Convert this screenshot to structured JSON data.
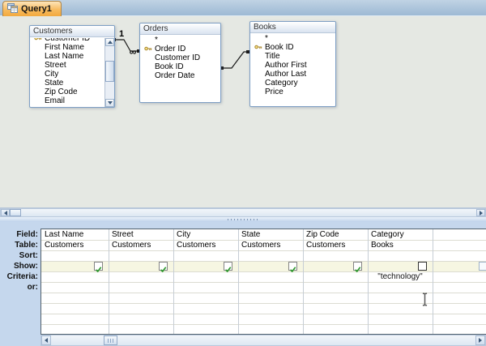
{
  "window": {
    "tab_label": "Query1"
  },
  "design": {
    "tables": [
      {
        "name": "Customers",
        "fields": [
          {
            "label": "Customer ID",
            "key": true,
            "partial": true
          },
          {
            "label": "First Name"
          },
          {
            "label": "Last Name"
          },
          {
            "label": "Street"
          },
          {
            "label": "City"
          },
          {
            "label": "State"
          },
          {
            "label": "Zip Code"
          },
          {
            "label": "Email"
          }
        ],
        "has_scrollbar": true
      },
      {
        "name": "Orders",
        "fields": [
          {
            "label": "*"
          },
          {
            "label": "Order ID",
            "key": true
          },
          {
            "label": "Customer ID"
          },
          {
            "label": "Book ID"
          },
          {
            "label": "Order Date"
          }
        ]
      },
      {
        "name": "Books",
        "fields": [
          {
            "label": "*"
          },
          {
            "label": "Book ID",
            "key": true
          },
          {
            "label": "Title"
          },
          {
            "label": "Author First"
          },
          {
            "label": "Author Last"
          },
          {
            "label": "Category"
          },
          {
            "label": "Price"
          }
        ]
      }
    ],
    "relationships": [
      {
        "from": "Customers",
        "to": "Orders",
        "from_label": "1",
        "to_label": "∞"
      },
      {
        "from": "Orders",
        "to": "Books",
        "from_label": "",
        "to_label": ""
      }
    ]
  },
  "grid": {
    "row_labels": [
      "Field:",
      "Table:",
      "Sort:",
      "Show:",
      "Criteria:",
      "or:"
    ],
    "columns": [
      {
        "field": "Last Name",
        "table": "Customers",
        "sort": "",
        "show": true,
        "criteria": "",
        "or": ""
      },
      {
        "field": "Street",
        "table": "Customers",
        "sort": "",
        "show": true,
        "criteria": "",
        "or": ""
      },
      {
        "field": "City",
        "table": "Customers",
        "sort": "",
        "show": true,
        "criteria": "",
        "or": ""
      },
      {
        "field": "State",
        "table": "Customers",
        "sort": "",
        "show": true,
        "criteria": "",
        "or": ""
      },
      {
        "field": "Zip Code",
        "table": "Customers",
        "sort": "",
        "show": true,
        "criteria": "",
        "or": ""
      },
      {
        "field": "Category",
        "table": "Books",
        "sort": "",
        "show": false,
        "criteria": "\"technology\"",
        "or": ""
      }
    ],
    "next_column_checkbox": true
  },
  "colors": {
    "active_tab": "#f5b55c",
    "grid_background": "#c5d7ed",
    "show_row": "#f6f6e2",
    "checkmark_green": "#2e9b2e",
    "key_gold": "#a8862a"
  }
}
